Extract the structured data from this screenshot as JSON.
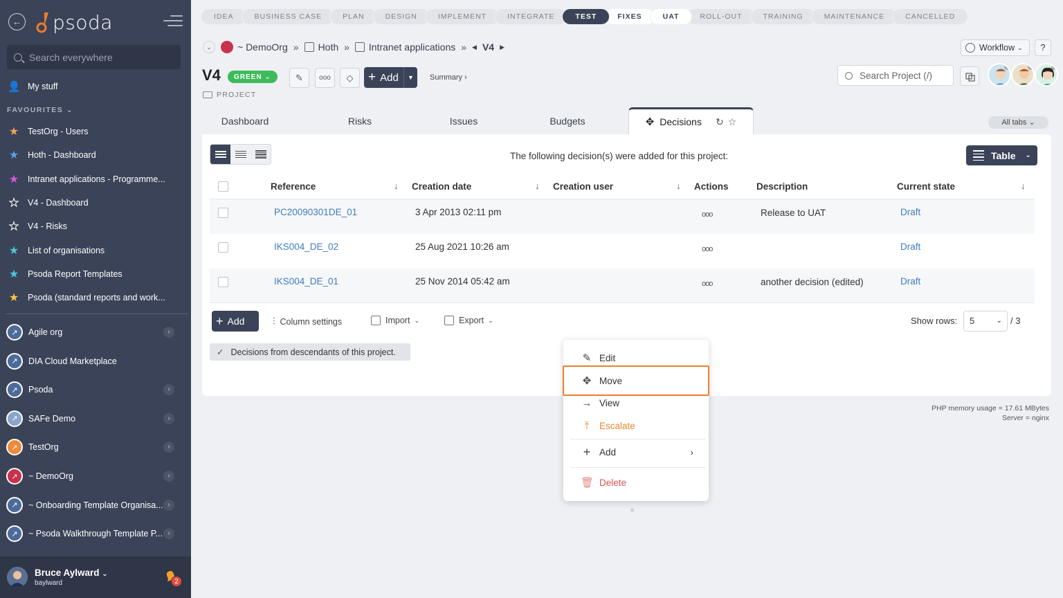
{
  "sidebar": {
    "search_placeholder": "Search everywhere",
    "my_stuff": "My stuff",
    "favourites_heading": "FAVOURITES",
    "favourites": [
      {
        "label": "TestOrg - Users",
        "color": "#f0a55a"
      },
      {
        "label": "Hoth - Dashboard",
        "color": "#5aa0e6"
      },
      {
        "label": "Intranet applications - Programme...",
        "color": "#d45ad8"
      },
      {
        "label": "V4 - Dashboard",
        "color": "#2f3647"
      },
      {
        "label": "V4 - Risks",
        "color": "#2f3647"
      },
      {
        "label": "List of organisations",
        "color": "#4ec7d8"
      },
      {
        "label": "Psoda Report Templates",
        "color": "#4ec7d8"
      },
      {
        "label": "Psoda (standard reports and work...",
        "color": "#f5c542"
      }
    ],
    "orgs": [
      {
        "label": "Agile org",
        "arrow": true,
        "ico": "#4d6b9a"
      },
      {
        "label": "DIA Cloud Marketplace",
        "arrow": false,
        "ico": "#4d6b9a"
      },
      {
        "label": "Psoda",
        "arrow": true,
        "ico": "#4d6b9a"
      },
      {
        "label": "SAFe Demo",
        "arrow": true,
        "ico": "#8aa6cc"
      },
      {
        "label": "TestOrg",
        "arrow": true,
        "ico": "#ee8a3a"
      },
      {
        "label": "~ DemoOrg",
        "arrow": true,
        "ico": "#c8324a"
      },
      {
        "label": "~ Onboarding Template Organisa...",
        "arrow": true,
        "ico": "#4d6b9a"
      },
      {
        "label": "~ Psoda Walkthrough Template P...",
        "arrow": true,
        "ico": "#4d6b9a"
      }
    ],
    "user": {
      "name": "Bruce Aylward",
      "login": "baylward",
      "notifications": "2"
    }
  },
  "logo_text": "psoda",
  "stages": [
    {
      "label": "IDEA",
      "state": ""
    },
    {
      "label": "BUSINESS CASE",
      "state": ""
    },
    {
      "label": "PLAN",
      "state": ""
    },
    {
      "label": "DESIGN",
      "state": ""
    },
    {
      "label": "IMPLEMENT",
      "state": ""
    },
    {
      "label": "INTEGRATE",
      "state": ""
    },
    {
      "label": "TEST",
      "state": "active"
    },
    {
      "label": "FIXES",
      "state": "light"
    },
    {
      "label": "UAT",
      "state": "light"
    },
    {
      "label": "ROLL-OUT",
      "state": ""
    },
    {
      "label": "TRAINING",
      "state": ""
    },
    {
      "label": "MAINTENANCE",
      "state": ""
    },
    {
      "label": "CANCELLED",
      "state": ""
    }
  ],
  "breadcrumb": {
    "org": "~ DemoOrg",
    "prog": "Hoth",
    "portfolio": "Intranet applications",
    "project": "V4"
  },
  "project": {
    "title": "V4",
    "status": "GREEN",
    "type_label": "PROJECT"
  },
  "toolbar": {
    "add_label": "Add",
    "summary_label": "Summary ›"
  },
  "workflow_label": "Workflow",
  "help_label": "?",
  "search_project_placeholder": "Search Project (/)",
  "tabs": [
    "Dashboard",
    "Risks",
    "Issues",
    "Budgets",
    "Decisions"
  ],
  "all_tabs_label": "All tabs",
  "panel": {
    "caption": "The following decision(s) were added for this project:",
    "table_btn": "Table",
    "columns": {
      "reference": "Reference",
      "creation_date": "Creation date",
      "creation_user": "Creation user",
      "actions": "Actions",
      "description": "Description",
      "current_state": "Current state"
    },
    "rows": [
      {
        "ref": "PC20090301DE_01",
        "date": "3 Apr 2013 02:11 pm",
        "desc": "Release to UAT",
        "state": "Draft"
      },
      {
        "ref": "IKS004_DE_02",
        "date": "25 Aug 2021 10:26 am",
        "desc": "",
        "state": "Draft"
      },
      {
        "ref": "IKS004_DE_01",
        "date": "25 Nov 2014 05:42 am",
        "desc": "another decision (edited)",
        "state": "Draft"
      }
    ],
    "add_label": "Add",
    "column_settings": "Column settings",
    "import_label": "Import",
    "export_label": "Export",
    "show_rows_label": "Show rows:",
    "rows_value": "5",
    "rows_total": "/ 3",
    "descendants_chip": "Decisions from descendants of this project."
  },
  "context_menu": {
    "edit": "Edit",
    "move": "Move",
    "view": "View",
    "escalate": "Escalate",
    "add": "Add",
    "delete": "Delete"
  },
  "footer": {
    "memory": "PHP memory usage = 17.61 MBytes",
    "server": "Server = nginx"
  }
}
